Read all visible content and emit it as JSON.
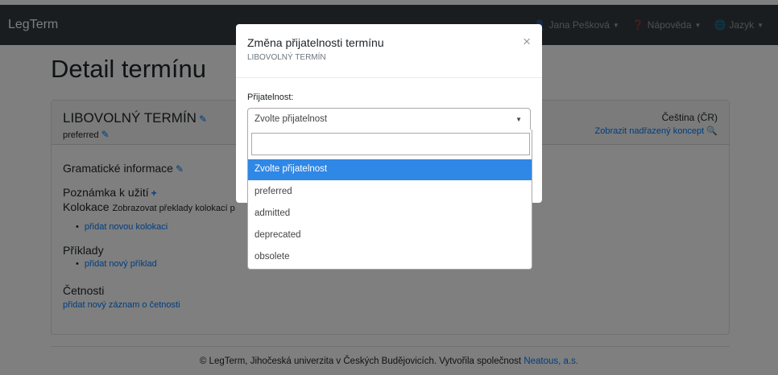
{
  "navbar": {
    "brand": "LegTerm",
    "user": "Jana Pešková",
    "help": "Nápověda",
    "language": "Jazyk"
  },
  "page": {
    "title": "Detail termínu",
    "term_name": "LIBOVOLNÝ TERMÍN",
    "term_status": "preferred",
    "term_language": "Čeština (ČR)",
    "parent_concept_link": "Zobrazit nadřazený koncept",
    "grammar_heading": "Gramatické informace",
    "usage_note_heading": "Poznámka k užití",
    "collocations_heading": "Kolokace",
    "collocations_note": "Zobrazovat překlady kolokací p",
    "add_collocation": "přidat novou kolokaci",
    "examples_heading": "Příklady",
    "add_example": "přidat nový příklad",
    "frequencies_heading": "Četnosti",
    "add_frequency": "přidat nový záznam o četnosti"
  },
  "footer": {
    "text": "© LegTerm, Jihočeská univerzita v Českých Budějovicích. Vytvořila společnost",
    "link": "Neatous, a.s."
  },
  "modal": {
    "title": "Změna přijatelnosti termínu",
    "subtitle": "LIBOVOLNÝ TERMÍN",
    "close": "×",
    "field_label": "Přijatelnost:",
    "selected_value": "Zvolte přijatelnost",
    "options": [
      "Zvolte přijatelnost",
      "preferred",
      "admitted",
      "deprecated",
      "obsolete"
    ]
  },
  "colors": {
    "navbar": "#343a40",
    "accent": "#007bff",
    "highlight": "#2f87e6"
  }
}
